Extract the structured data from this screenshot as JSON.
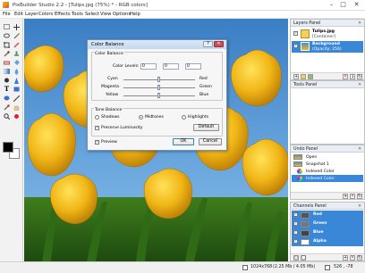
{
  "window": {
    "title": "PixBuilder Studio 2.2 - [Tulips.jpg (75%) * - RGB colors]"
  },
  "menu": [
    "File",
    "Edit",
    "Layer",
    "Colors",
    "Effects",
    "Tools",
    "Select",
    "View",
    "Options",
    "Help"
  ],
  "dialog": {
    "title": "Color Balance",
    "color_balance_legend": "Color Balance",
    "color_levels_label": "Color Levels:",
    "levels": [
      "0",
      "0",
      "0"
    ],
    "sliders": [
      {
        "left": "Cyan",
        "right": "Red"
      },
      {
        "left": "Magenta",
        "right": "Green"
      },
      {
        "left": "Yellow",
        "right": "Blue"
      }
    ],
    "tone_legend": "Tone Balance",
    "tones": [
      "Shadows",
      "Midtones",
      "Highlights"
    ],
    "selected_tone": "Midtones",
    "preserve_label": "Preserve Luminosity",
    "default_label": "Default",
    "preview_label": "Preview",
    "ok_label": "OK",
    "cancel_label": "Cancel"
  },
  "layers_panel": {
    "title": "Layers Panel",
    "layers": [
      {
        "name": "Tulips.jpg",
        "sub": "[Container]"
      },
      {
        "name": "Background",
        "sub": "(Opacity: 256)"
      }
    ]
  },
  "tools_panel": {
    "title": "Tools Panel"
  },
  "undo_panel": {
    "title": "Undo Panel",
    "items": [
      "Open",
      "Snapshot 1",
      "Indexed Color",
      "Indexed Color"
    ]
  },
  "channels_panel": {
    "title": "Channels Panel",
    "channels": [
      "Red",
      "Green",
      "Blue",
      "Alpha"
    ]
  },
  "status": {
    "dimensions": "1024x768",
    "memory": "(2.25 Mb / 4.05 Mb)",
    "coords": "526 , -78"
  },
  "colors": {
    "accent": "#3a87d8",
    "tulip_yellow": "#f1b616",
    "sky": "#4b91cf",
    "foreground_color": "#000000",
    "background_color": "#ffffff"
  }
}
